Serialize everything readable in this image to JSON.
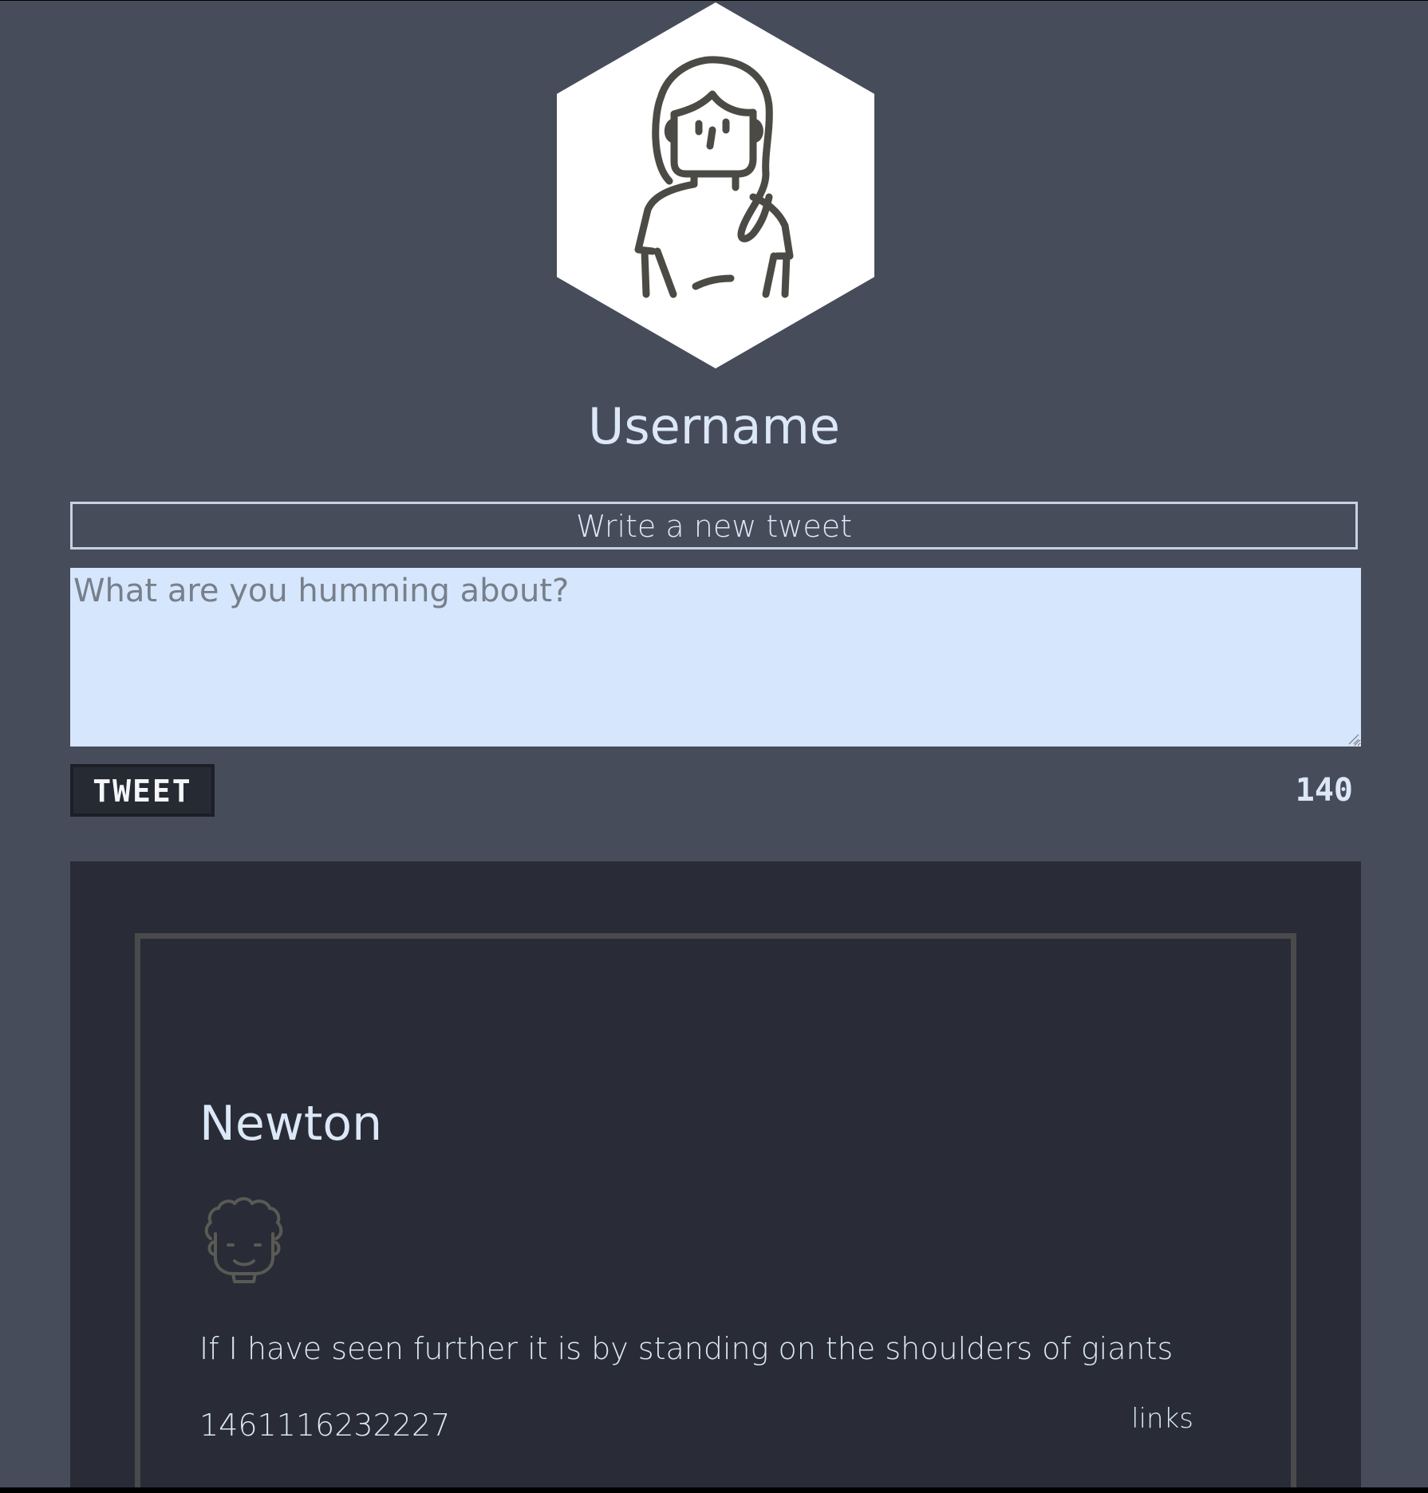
{
  "profile": {
    "username": "Username",
    "avatar_icon": "woman-avatar-icon"
  },
  "compose": {
    "header": "Write a new tweet",
    "placeholder": "What are you humming about?",
    "tweet_button_label": "TWEET",
    "char_count": "140"
  },
  "feed": {
    "tweets": [
      {
        "author": "Newton",
        "avatar_icon": "curly-hair-man-avatar-icon",
        "text": "If I have seen further it is by standing on the shoulders of giants",
        "timestamp": "1461116232227",
        "links_label": "links"
      }
    ]
  },
  "colors": {
    "page_background": "#474c5a",
    "feed_background": "#292c36",
    "text_light": "#dce8f8",
    "textarea_background": "#d6e6fd",
    "button_background": "#262a33"
  }
}
